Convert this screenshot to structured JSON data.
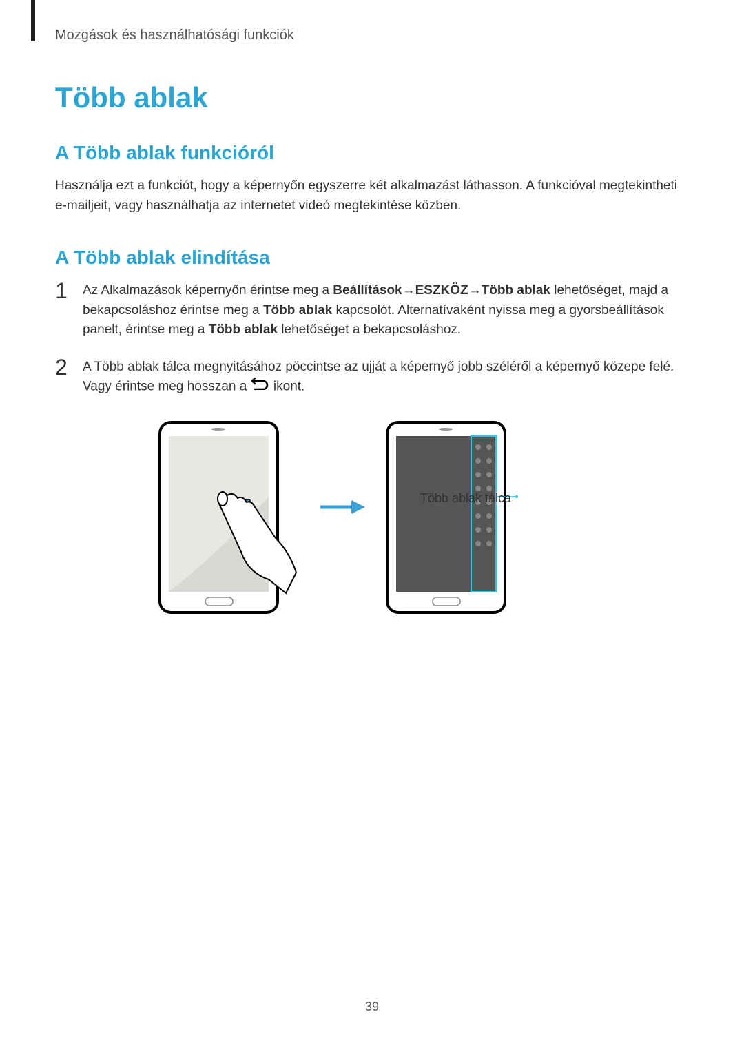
{
  "breadcrumb": "Mozgások és használhatósági funkciók",
  "main_title": "Több ablak",
  "section1": {
    "title": "A Több ablak funkcióról",
    "body": "Használja ezt a funkciót, hogy a képernyőn egyszerre két alkalmazást láthasson. A funkcióval megtekintheti e-mailjeit, vagy használhatja az internetet videó megtekintése közben."
  },
  "section2": {
    "title": "A Több ablak elindítása",
    "step1": {
      "num": "1",
      "pre": "Az Alkalmazások képernyőn érintse meg a ",
      "bold1": "Beállítások",
      "arrow1": " → ",
      "bold2": "ESZKÖZ",
      "arrow2": " → ",
      "bold3": "Több ablak",
      "post1": " lehetőséget, majd a bekapcsoláshoz érintse meg a ",
      "bold4": "Több ablak",
      "post2": " kapcsolót. Alternatívaként nyissa meg a gyorsbeállítások panelt, érintse meg a ",
      "bold5": "Több ablak",
      "post3": " lehetőséget a bekapcsoláshoz."
    },
    "step2": {
      "num": "2",
      "pre": "A Több ablak tálca megnyitásához pöccintse az ujját a képernyő jobb széléről a képernyő közepe felé. Vagy érintse meg hosszan a ",
      "post": " ikont."
    }
  },
  "caption": "Több ablak tálca",
  "page_number": "39"
}
